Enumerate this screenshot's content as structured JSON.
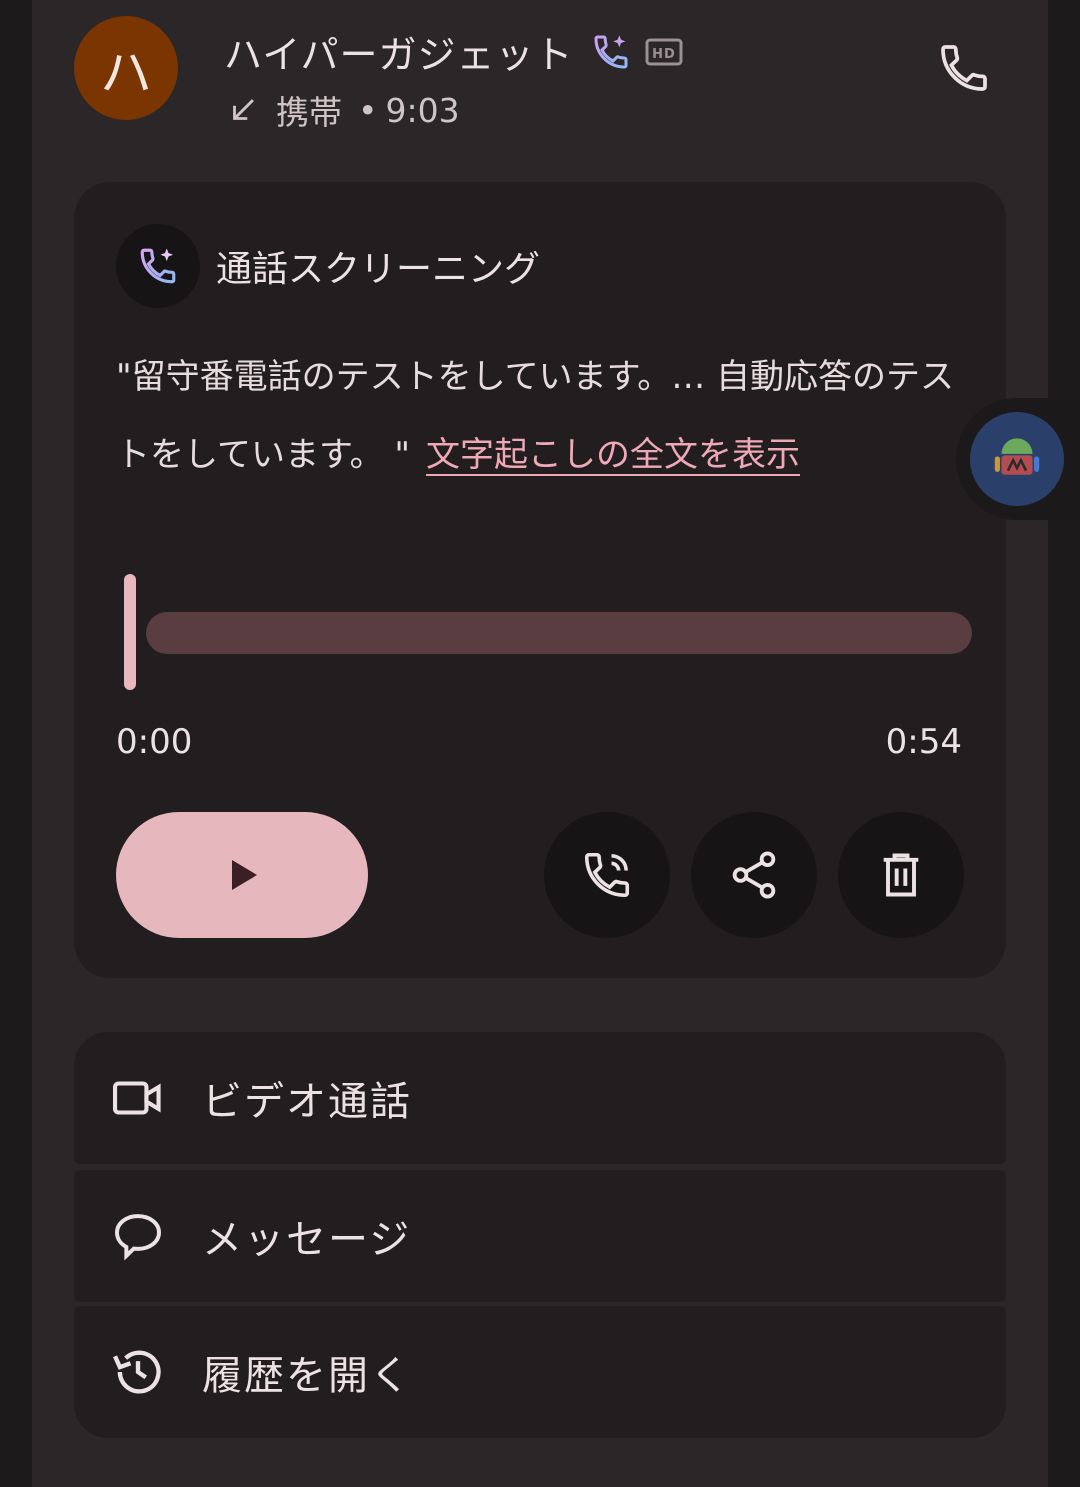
{
  "contact": {
    "avatar_initial": "ハ",
    "avatar_color": "#7a3500",
    "name": "ハイパーガジェット",
    "badge_hd": "HD",
    "call_type": "携帯",
    "separator": "•",
    "time": "9:03",
    "direction_icon": "incoming-arrow-icon"
  },
  "screening": {
    "title": "通話スクリーニング",
    "transcript": "\"留守番電話のテストをしています。… 自動応答のテストをしています。 \"",
    "view_full_transcript": "文字起こしの全文を表示",
    "player": {
      "position": "0:00",
      "duration": "0:54",
      "progress": 0
    }
  },
  "actions": [
    {
      "label": "ビデオ通話",
      "icon": "video-call-icon"
    },
    {
      "label": "メッセージ",
      "icon": "message-icon"
    },
    {
      "label": "履歴を開く",
      "icon": "history-icon"
    }
  ],
  "colors": {
    "accent": "#e6b8bd",
    "link": "#efa8b5",
    "card_bg": "#221e1f",
    "panel_bg": "#2b2628"
  }
}
